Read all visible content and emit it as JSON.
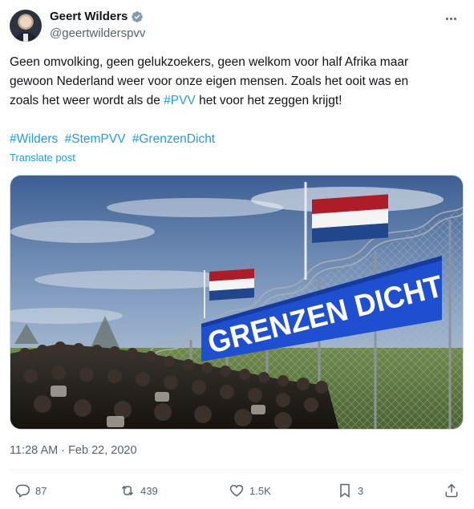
{
  "author": {
    "display_name": "Geert Wilders",
    "handle": "@geertwilderspvv",
    "verified": true,
    "avatar_icon": "profile-photo"
  },
  "post": {
    "lines": [
      "Geen omvolking, geen gelukzoekers, geen welkom voor half Afrika maar",
      "gewoon Nederland weer voor onze eigen mensen. Zoals het ooit was en"
    ],
    "line3_before": "zoals het weer wordt als de ",
    "line3_tag": "#PVV",
    "line3_after": " het voor het zeggen krijgt!",
    "hashtags": [
      "#Wilders",
      "#StemPVV",
      "#GrenzenDicht"
    ],
    "translate_label": "Translate post"
  },
  "media": {
    "banner_text": "GRENZEN DICHT",
    "description_icon": "border-fence-photo"
  },
  "meta": {
    "timestamp": "11:28 AM · Feb 22, 2020"
  },
  "actions": {
    "replies": "87",
    "reposts": "439",
    "likes": "1.5K",
    "bookmarks": "3"
  },
  "colors": {
    "accent": "#1d9bf0",
    "text": "#0f1419",
    "secondary": "#536471",
    "banner_blue": "#1f4fd1"
  }
}
